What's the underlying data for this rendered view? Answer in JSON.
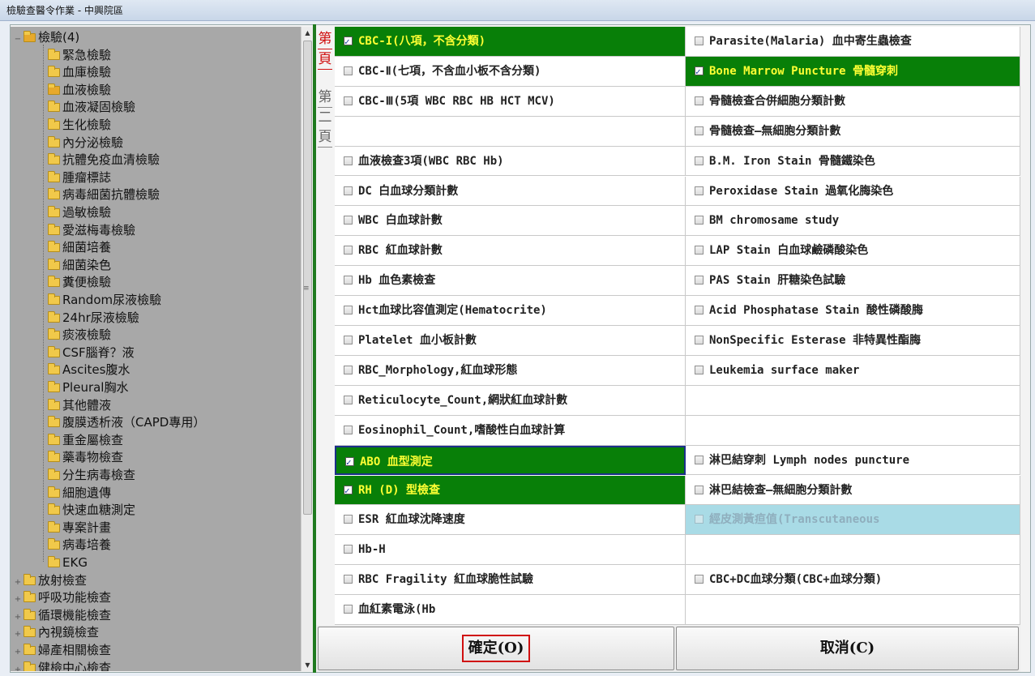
{
  "window": {
    "title": "檢驗查醫令作業 - 中興院區"
  },
  "tree": {
    "root": {
      "label": "檢驗(4)",
      "toggle": "−"
    },
    "children": [
      "緊急檢驗",
      "血庫檢驗",
      "血液檢驗",
      "血液凝固檢驗",
      "生化檢驗",
      "內分泌檢驗",
      "抗體免疫血清檢驗",
      "腫瘤標誌",
      "病毒細菌抗體檢驗",
      "過敏檢驗",
      "愛滋梅毒檢驗",
      "細菌培養",
      "細菌染色",
      "糞便檢驗",
      "Random尿液檢驗",
      "24hr尿液檢驗",
      "痰液檢驗",
      "CSF腦脊？液",
      "Ascites腹水",
      "Pleural胸水",
      "其他體液",
      "腹膜透析液（CAPD專用）",
      "重金屬檢查",
      "藥毒物檢查",
      "分生病毒檢查",
      "細胞遺傳",
      "快速血糖測定",
      "專案計畫",
      "病毒培養",
      "EKG"
    ],
    "open_child_index": 2,
    "top_groups": [
      "放射檢查",
      "呼吸功能檢查",
      "循環機能檢查",
      "內視鏡檢查",
      "婦產相關檢查",
      "健檢中心檢查"
    ],
    "toggle_plus": "+"
  },
  "scrollbar": {
    "up": "▲",
    "down": "▼",
    "grip": "≡"
  },
  "pages": [
    {
      "line1": "第",
      "line2": "頁",
      "active": true
    },
    {
      "line1": "第",
      "line2": "二",
      "line3": "頁",
      "active": false
    }
  ],
  "grid": {
    "left": [
      {
        "label": "CBC-I(八項，不含分類)",
        "checked": true
      },
      {
        "label": "CBC-Ⅱ(七項，不含血小板不含分類)",
        "checked": false
      },
      {
        "label": "CBC-Ⅲ(5項 WBC RBC HB HCT MCV)",
        "checked": false
      },
      {
        "label": "",
        "empty": true
      },
      {
        "label": "血液檢查3項(WBC RBC Hb)",
        "checked": false
      },
      {
        "label": "DC 白血球分類計數",
        "checked": false
      },
      {
        "label": "WBC  白血球計數",
        "checked": false
      },
      {
        "label": "RBC 紅血球計數",
        "checked": false
      },
      {
        "label": "Hb 血色素檢查",
        "checked": false
      },
      {
        "label": "Hct血球比容值測定(Hematocrite)",
        "checked": false
      },
      {
        "label": "Platelet  血小板計數",
        "checked": false
      },
      {
        "label": "RBC_Morphology,紅血球形態",
        "checked": false
      },
      {
        "label": "Reticulocyte_Count,網狀紅血球計數",
        "checked": false
      },
      {
        "label": "Eosinophil_Count,嗜酸性白血球計算",
        "checked": false
      },
      {
        "label": "ABO 血型測定",
        "checked": true,
        "focus": true
      },
      {
        "label": "RH (D) 型檢查",
        "checked": true
      },
      {
        "label": "ESR 紅血球沈降速度",
        "checked": false
      },
      {
        "label": "Hb-H",
        "checked": false
      },
      {
        "label": "RBC Fragility 紅血球脆性試驗",
        "checked": false
      },
      {
        "label": "血紅素電泳(Hb",
        "checked": false
      }
    ],
    "right": [
      {
        "label": "Parasite(Malaria) 血中寄生蟲檢查",
        "checked": false
      },
      {
        "label": "Bone Marrow Puncture 骨髓穿刺",
        "checked": true
      },
      {
        "label": "骨髓檢查合併細胞分類計數",
        "checked": false
      },
      {
        "label": "骨髓檢查—無細胞分類計數",
        "checked": false
      },
      {
        "label": "B.M. Iron Stain 骨髓鐵染色",
        "checked": false
      },
      {
        "label": "Peroxidase Stain 過氧化脢染色",
        "checked": false
      },
      {
        "label": "BM chromosame study",
        "checked": false
      },
      {
        "label": "LAP Stain 白血球鹼磷酸染色",
        "checked": false
      },
      {
        "label": "PAS Stain 肝糖染色試驗",
        "checked": false
      },
      {
        "label": "Acid Phosphatase Stain 酸性磷酸脢",
        "checked": false
      },
      {
        "label": "NonSpecific Esterase 非特異性酯脢",
        "checked": false
      },
      {
        "label": "Leukemia surface maker",
        "checked": false
      },
      {
        "label": "",
        "empty": true
      },
      {
        "label": "",
        "empty": true
      },
      {
        "label": "淋巴結穿刺 Lymph nodes puncture",
        "checked": false
      },
      {
        "label": "淋巴結檢查—無細胞分類計數",
        "checked": false
      },
      {
        "label": "經皮測黃疸值(Transcutaneous",
        "checked": false,
        "disabled": true
      },
      {
        "label": "",
        "empty": true
      },
      {
        "label": "CBC+DC血球分類(CBC+血球分類)",
        "checked": false
      },
      {
        "label": "",
        "empty": true
      }
    ]
  },
  "buttons": {
    "ok": "確定(O)",
    "cancel": "取消(C)"
  },
  "colors": {
    "checked_bg": "#087f08",
    "checked_text": "#ffff33",
    "tree_bg": "#a8a8a8",
    "highlight": "#d01010"
  }
}
